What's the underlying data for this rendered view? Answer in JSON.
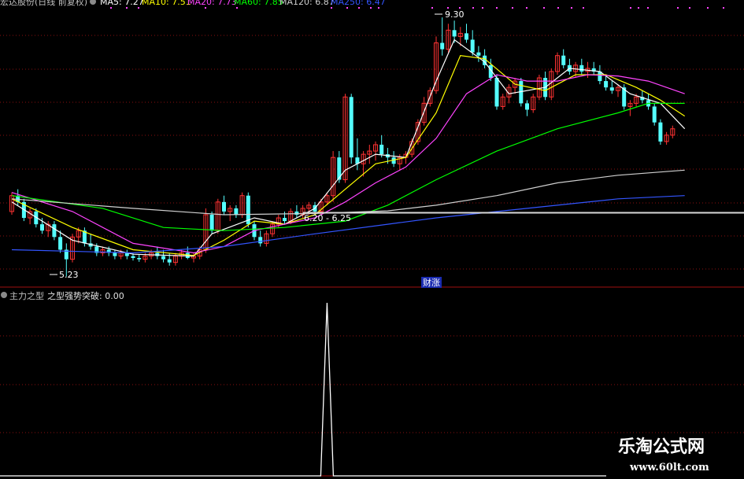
{
  "main_panel": {
    "title": "宏达股份(日线 前复权)",
    "legend": [
      {
        "label": "MA5: 7.27",
        "color": "#ffffff"
      },
      {
        "label": "MA10: 7.51",
        "color": "#ffff00"
      },
      {
        "label": "MA20: 7.73",
        "color": "#ff44ff"
      },
      {
        "label": "MA60: 7.85",
        "color": "#00ff00"
      },
      {
        "label": "MA120: 6.87",
        "color": "#d0d0d0"
      },
      {
        "label": "MA250: 6.47",
        "color": "#3355ff"
      }
    ],
    "annotations": {
      "high": "9.30",
      "low": "5.23",
      "range": "6.20 - 6.25",
      "tag": "财涨"
    }
  },
  "sub_panel": {
    "title": "主力之型",
    "indicator": "之型强势突破: 0.00"
  },
  "watermark": {
    "title": "乐淘公式网",
    "url": "www.60lt.com"
  },
  "chart_data": {
    "type": "candlestick",
    "ohlc": [
      [
        6.25,
        6.55,
        6.2,
        6.5
      ],
      [
        6.5,
        6.6,
        6.35,
        6.4
      ],
      [
        6.4,
        6.45,
        6.1,
        6.15
      ],
      [
        6.15,
        6.3,
        6.05,
        6.25
      ],
      [
        6.25,
        6.3,
        6.0,
        6.05
      ],
      [
        6.05,
        6.15,
        5.9,
        5.95
      ],
      [
        5.95,
        6.1,
        5.85,
        6.05
      ],
      [
        6.05,
        6.1,
        5.8,
        5.85
      ],
      [
        5.85,
        5.95,
        5.6,
        5.65
      ],
      [
        5.65,
        5.75,
        5.23,
        5.5
      ],
      [
        5.5,
        5.9,
        5.45,
        5.85
      ],
      [
        5.85,
        6.0,
        5.75,
        5.95
      ],
      [
        5.95,
        6.0,
        5.7,
        5.75
      ],
      [
        5.75,
        5.9,
        5.65,
        5.7
      ],
      [
        5.7,
        5.75,
        5.55,
        5.6
      ],
      [
        5.6,
        5.7,
        5.55,
        5.65
      ],
      [
        5.65,
        5.7,
        5.55,
        5.6
      ],
      [
        5.6,
        5.65,
        5.5,
        5.55
      ],
      [
        5.55,
        5.65,
        5.5,
        5.6
      ],
      [
        5.6,
        5.65,
        5.5,
        5.55
      ],
      [
        5.55,
        5.6,
        5.48,
        5.52
      ],
      [
        5.52,
        5.58,
        5.46,
        5.5
      ],
      [
        5.5,
        5.6,
        5.45,
        5.55
      ],
      [
        5.55,
        5.65,
        5.5,
        5.6
      ],
      [
        5.6,
        5.7,
        5.5,
        5.55
      ],
      [
        5.55,
        5.65,
        5.45,
        5.5
      ],
      [
        5.5,
        5.6,
        5.4,
        5.45
      ],
      [
        5.45,
        5.6,
        5.4,
        5.55
      ],
      [
        5.55,
        5.65,
        5.5,
        5.6
      ],
      [
        5.6,
        5.7,
        5.5,
        5.52
      ],
      [
        5.52,
        5.6,
        5.45,
        5.55
      ],
      [
        5.55,
        5.7,
        5.5,
        5.65
      ],
      [
        5.65,
        6.3,
        5.6,
        6.2
      ],
      [
        6.2,
        6.25,
        5.9,
        5.95
      ],
      [
        5.95,
        6.45,
        5.9,
        6.4
      ],
      [
        6.4,
        6.5,
        6.2,
        6.25
      ],
      [
        6.25,
        6.35,
        6.1,
        6.3
      ],
      [
        6.3,
        6.35,
        6.15,
        6.2
      ],
      [
        6.2,
        6.55,
        6.15,
        6.5
      ],
      [
        6.5,
        6.55,
        6.0,
        6.05
      ],
      [
        6.05,
        6.1,
        5.8,
        5.85
      ],
      [
        5.85,
        5.95,
        5.7,
        5.75
      ],
      [
        5.75,
        5.95,
        5.7,
        5.9
      ],
      [
        5.9,
        6.1,
        5.85,
        6.05
      ],
      [
        6.05,
        6.2,
        6.0,
        6.15
      ],
      [
        6.15,
        6.25,
        6.05,
        6.1
      ],
      [
        6.1,
        6.3,
        6.05,
        6.25
      ],
      [
        6.25,
        6.35,
        6.15,
        6.2
      ],
      [
        6.2,
        6.35,
        6.15,
        6.3
      ],
      [
        6.3,
        6.4,
        6.2,
        6.35
      ],
      [
        6.35,
        6.4,
        6.2,
        6.25
      ],
      [
        6.25,
        6.45,
        6.2,
        6.4
      ],
      [
        6.4,
        6.55,
        6.35,
        6.5
      ],
      [
        6.5,
        7.2,
        6.4,
        7.1
      ],
      [
        7.1,
        7.2,
        6.7,
        6.75
      ],
      [
        6.75,
        8.1,
        6.7,
        8.05
      ],
      [
        8.05,
        8.1,
        7.0,
        7.1
      ],
      [
        7.1,
        7.4,
        6.9,
        7.0
      ],
      [
        7.0,
        7.2,
        6.8,
        7.15
      ],
      [
        7.15,
        7.3,
        7.0,
        7.2
      ],
      [
        7.2,
        7.35,
        7.05,
        7.3
      ],
      [
        7.3,
        7.45,
        7.1,
        7.15
      ],
      [
        7.15,
        7.25,
        7.0,
        7.1
      ],
      [
        7.1,
        7.2,
        6.95,
        7.0
      ],
      [
        7.0,
        7.15,
        6.9,
        7.1
      ],
      [
        7.1,
        7.2,
        7.0,
        7.15
      ],
      [
        7.15,
        7.4,
        7.1,
        7.35
      ],
      [
        7.35,
        7.7,
        7.3,
        7.65
      ],
      [
        7.65,
        8.05,
        7.6,
        7.95
      ],
      [
        7.95,
        8.2,
        7.9,
        8.15
      ],
      [
        8.15,
        9.0,
        8.1,
        8.9
      ],
      [
        8.9,
        9.3,
        8.7,
        8.8
      ],
      [
        8.8,
        9.2,
        8.75,
        9.1
      ],
      [
        9.1,
        9.25,
        8.9,
        9.0
      ],
      [
        9.0,
        9.15,
        8.85,
        9.05
      ],
      [
        9.05,
        9.2,
        8.9,
        8.95
      ],
      [
        8.95,
        9.1,
        8.7,
        8.75
      ],
      [
        8.75,
        8.85,
        8.6,
        8.7
      ],
      [
        8.7,
        8.8,
        8.5,
        8.55
      ],
      [
        8.55,
        8.65,
        8.3,
        8.35
      ],
      [
        8.35,
        8.4,
        7.85,
        7.9
      ],
      [
        7.9,
        8.1,
        7.85,
        8.05
      ],
      [
        8.05,
        8.25,
        7.95,
        8.2
      ],
      [
        8.2,
        8.35,
        8.1,
        8.3
      ],
      [
        8.3,
        8.35,
        7.9,
        7.95
      ],
      [
        7.95,
        8.0,
        7.75,
        7.85
      ],
      [
        7.85,
        8.1,
        7.8,
        8.05
      ],
      [
        8.05,
        8.4,
        8.0,
        8.35
      ],
      [
        8.35,
        8.45,
        8.0,
        8.05
      ],
      [
        8.05,
        8.5,
        8.0,
        8.45
      ],
      [
        8.45,
        8.75,
        8.4,
        8.7
      ],
      [
        8.7,
        8.8,
        8.5,
        8.55
      ],
      [
        8.55,
        8.65,
        8.4,
        8.45
      ],
      [
        8.45,
        8.6,
        8.35,
        8.55
      ],
      [
        8.55,
        8.65,
        8.4,
        8.45
      ],
      [
        8.45,
        8.6,
        8.35,
        8.5
      ],
      [
        8.5,
        8.6,
        8.4,
        8.45
      ],
      [
        8.45,
        8.55,
        8.25,
        8.3
      ],
      [
        8.3,
        8.4,
        8.15,
        8.2
      ],
      [
        8.2,
        8.3,
        8.1,
        8.15
      ],
      [
        8.15,
        8.25,
        8.05,
        8.2
      ],
      [
        8.2,
        8.25,
        7.85,
        7.9
      ],
      [
        7.9,
        8.0,
        7.75,
        7.95
      ],
      [
        7.95,
        8.1,
        7.9,
        8.05
      ],
      [
        8.05,
        8.15,
        7.95,
        8.0
      ],
      [
        8.0,
        8.1,
        7.85,
        7.9
      ],
      [
        7.9,
        7.95,
        7.6,
        7.65
      ],
      [
        7.65,
        7.7,
        7.3,
        7.35
      ],
      [
        7.35,
        7.5,
        7.3,
        7.45
      ],
      [
        7.45,
        7.6,
        7.4,
        7.55
      ]
    ],
    "ma_series": [
      {
        "name": "MA5",
        "color": "#ffffff",
        "points": [
          [
            0,
            6.4
          ],
          [
            10,
            5.8
          ],
          [
            20,
            5.58
          ],
          [
            30,
            5.55
          ],
          [
            33,
            5.9
          ],
          [
            40,
            6.15
          ],
          [
            45,
            6.05
          ],
          [
            50,
            6.3
          ],
          [
            55,
            6.9
          ],
          [
            60,
            7.15
          ],
          [
            65,
            7.1
          ],
          [
            70,
            8.3
          ],
          [
            73,
            8.95
          ],
          [
            78,
            8.6
          ],
          [
            82,
            8.1
          ],
          [
            88,
            8.2
          ],
          [
            92,
            8.5
          ],
          [
            97,
            8.45
          ],
          [
            102,
            8.1
          ],
          [
            107,
            7.95
          ],
          [
            111,
            7.55
          ]
        ]
      },
      {
        "name": "MA10",
        "color": "#ffff00",
        "points": [
          [
            0,
            6.45
          ],
          [
            10,
            6.0
          ],
          [
            20,
            5.65
          ],
          [
            30,
            5.56
          ],
          [
            35,
            5.8
          ],
          [
            40,
            6.1
          ],
          [
            45,
            6.05
          ],
          [
            50,
            6.2
          ],
          [
            55,
            6.6
          ],
          [
            60,
            7.0
          ],
          [
            65,
            7.1
          ],
          [
            70,
            7.8
          ],
          [
            74,
            8.7
          ],
          [
            78,
            8.65
          ],
          [
            83,
            8.25
          ],
          [
            88,
            8.15
          ],
          [
            93,
            8.4
          ],
          [
            98,
            8.4
          ],
          [
            103,
            8.2
          ],
          [
            107,
            8.0
          ],
          [
            111,
            7.75
          ]
        ]
      },
      {
        "name": "MA20",
        "color": "#ff44ff",
        "points": [
          [
            0,
            6.55
          ],
          [
            10,
            6.25
          ],
          [
            20,
            5.75
          ],
          [
            30,
            5.6
          ],
          [
            35,
            5.7
          ],
          [
            40,
            5.95
          ],
          [
            45,
            6.05
          ],
          [
            50,
            6.15
          ],
          [
            55,
            6.4
          ],
          [
            60,
            6.7
          ],
          [
            65,
            6.95
          ],
          [
            70,
            7.4
          ],
          [
            75,
            8.1
          ],
          [
            80,
            8.4
          ],
          [
            85,
            8.3
          ],
          [
            90,
            8.3
          ],
          [
            95,
            8.4
          ],
          [
            100,
            8.38
          ],
          [
            105,
            8.3
          ],
          [
            111,
            8.1
          ]
        ]
      },
      {
        "name": "MA60",
        "color": "#00ff00",
        "points": [
          [
            0,
            6.5
          ],
          [
            15,
            6.3
          ],
          [
            25,
            6.0
          ],
          [
            35,
            5.95
          ],
          [
            45,
            6.0
          ],
          [
            55,
            6.1
          ],
          [
            62,
            6.35
          ],
          [
            70,
            6.75
          ],
          [
            80,
            7.2
          ],
          [
            90,
            7.55
          ],
          [
            100,
            7.8
          ],
          [
            105,
            7.95
          ],
          [
            111,
            7.95
          ]
        ]
      },
      {
        "name": "MA120",
        "color": "#d0d0d0",
        "points": [
          [
            0,
            6.45
          ],
          [
            20,
            6.3
          ],
          [
            35,
            6.2
          ],
          [
            50,
            6.22
          ],
          [
            62,
            6.26
          ],
          [
            70,
            6.35
          ],
          [
            80,
            6.5
          ],
          [
            90,
            6.7
          ],
          [
            100,
            6.82
          ],
          [
            111,
            6.9
          ]
        ]
      },
      {
        "name": "MA250",
        "color": "#3355ff",
        "points": [
          [
            0,
            5.65
          ],
          [
            20,
            5.6
          ],
          [
            35,
            5.7
          ],
          [
            50,
            5.9
          ],
          [
            62,
            6.05
          ],
          [
            70,
            6.15
          ],
          [
            85,
            6.3
          ],
          [
            100,
            6.45
          ],
          [
            111,
            6.5
          ]
        ]
      }
    ],
    "price_range": [
      5.1,
      9.45
    ],
    "support_level": 6.23,
    "sub_series": {
      "name": "之型强势突破",
      "spike_index": 52,
      "spike_value": 1
    }
  }
}
